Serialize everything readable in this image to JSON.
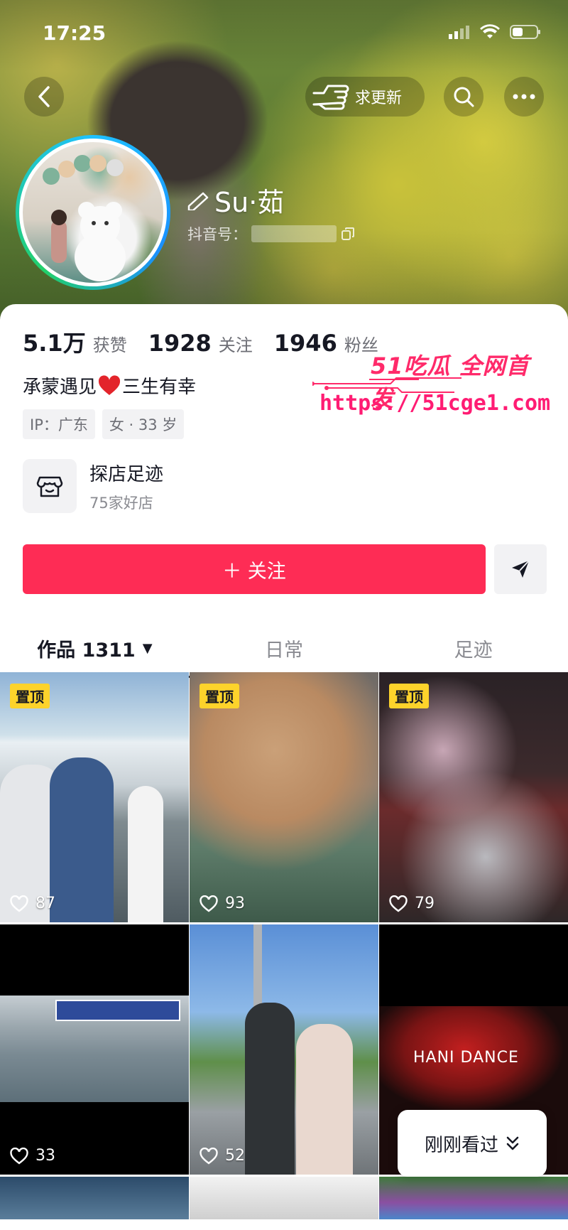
{
  "status_bar": {
    "time": "17:25"
  },
  "header": {
    "update_label": "求更新"
  },
  "profile": {
    "name": "Su·茹",
    "id_label": "抖音号：",
    "stats": [
      {
        "num": "5.1万",
        "label": "获赞"
      },
      {
        "num": "1928",
        "label": "关注"
      },
      {
        "num": "1946",
        "label": "粉丝"
      }
    ],
    "bio_prefix": "承蒙遇见",
    "bio_suffix": "三生有幸",
    "tags": [
      "IP：广东",
      "女 · 33 岁"
    ]
  },
  "watermark": {
    "title": "51吃瓜 全网首发",
    "url": "https://51cge1.com"
  },
  "shop": {
    "title": "探店足迹",
    "subtitle": "75家好店"
  },
  "follow_label": "＋ 关注",
  "tabs": [
    {
      "label": "作品 1311"
    },
    {
      "label": "日常"
    },
    {
      "label": "足迹"
    }
  ],
  "videos": [
    {
      "pinned": true,
      "pin_label": "置顶",
      "likes": "87"
    },
    {
      "pinned": true,
      "pin_label": "置顶",
      "likes": "93"
    },
    {
      "pinned": true,
      "pin_label": "置顶",
      "likes": "79"
    },
    {
      "pinned": false,
      "likes": "33"
    },
    {
      "pinned": false,
      "likes": "52"
    },
    {
      "pinned": false,
      "likes": "",
      "overlay_text": "HANI DANCE"
    }
  ],
  "recent_label": "刚刚看过",
  "colors": {
    "accent": "#fe2c55",
    "pin_badge": "#fdd32b",
    "text_primary": "#161823",
    "text_secondary": "#8a8b91"
  }
}
